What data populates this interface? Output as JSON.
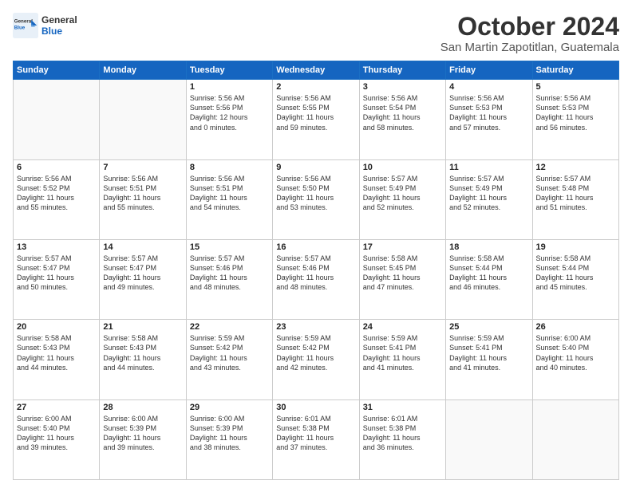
{
  "logo": {
    "general": "General",
    "blue": "Blue"
  },
  "title": "October 2024",
  "location": "San Martin Zapotitlan, Guatemala",
  "weekdays": [
    "Sunday",
    "Monday",
    "Tuesday",
    "Wednesday",
    "Thursday",
    "Friday",
    "Saturday"
  ],
  "weeks": [
    [
      {
        "day": "",
        "info": ""
      },
      {
        "day": "",
        "info": ""
      },
      {
        "day": "1",
        "info": "Sunrise: 5:56 AM\nSunset: 5:56 PM\nDaylight: 12 hours\nand 0 minutes."
      },
      {
        "day": "2",
        "info": "Sunrise: 5:56 AM\nSunset: 5:55 PM\nDaylight: 11 hours\nand 59 minutes."
      },
      {
        "day": "3",
        "info": "Sunrise: 5:56 AM\nSunset: 5:54 PM\nDaylight: 11 hours\nand 58 minutes."
      },
      {
        "day": "4",
        "info": "Sunrise: 5:56 AM\nSunset: 5:53 PM\nDaylight: 11 hours\nand 57 minutes."
      },
      {
        "day": "5",
        "info": "Sunrise: 5:56 AM\nSunset: 5:53 PM\nDaylight: 11 hours\nand 56 minutes."
      }
    ],
    [
      {
        "day": "6",
        "info": "Sunrise: 5:56 AM\nSunset: 5:52 PM\nDaylight: 11 hours\nand 55 minutes."
      },
      {
        "day": "7",
        "info": "Sunrise: 5:56 AM\nSunset: 5:51 PM\nDaylight: 11 hours\nand 55 minutes."
      },
      {
        "day": "8",
        "info": "Sunrise: 5:56 AM\nSunset: 5:51 PM\nDaylight: 11 hours\nand 54 minutes."
      },
      {
        "day": "9",
        "info": "Sunrise: 5:56 AM\nSunset: 5:50 PM\nDaylight: 11 hours\nand 53 minutes."
      },
      {
        "day": "10",
        "info": "Sunrise: 5:57 AM\nSunset: 5:49 PM\nDaylight: 11 hours\nand 52 minutes."
      },
      {
        "day": "11",
        "info": "Sunrise: 5:57 AM\nSunset: 5:49 PM\nDaylight: 11 hours\nand 52 minutes."
      },
      {
        "day": "12",
        "info": "Sunrise: 5:57 AM\nSunset: 5:48 PM\nDaylight: 11 hours\nand 51 minutes."
      }
    ],
    [
      {
        "day": "13",
        "info": "Sunrise: 5:57 AM\nSunset: 5:47 PM\nDaylight: 11 hours\nand 50 minutes."
      },
      {
        "day": "14",
        "info": "Sunrise: 5:57 AM\nSunset: 5:47 PM\nDaylight: 11 hours\nand 49 minutes."
      },
      {
        "day": "15",
        "info": "Sunrise: 5:57 AM\nSunset: 5:46 PM\nDaylight: 11 hours\nand 48 minutes."
      },
      {
        "day": "16",
        "info": "Sunrise: 5:57 AM\nSunset: 5:46 PM\nDaylight: 11 hours\nand 48 minutes."
      },
      {
        "day": "17",
        "info": "Sunrise: 5:58 AM\nSunset: 5:45 PM\nDaylight: 11 hours\nand 47 minutes."
      },
      {
        "day": "18",
        "info": "Sunrise: 5:58 AM\nSunset: 5:44 PM\nDaylight: 11 hours\nand 46 minutes."
      },
      {
        "day": "19",
        "info": "Sunrise: 5:58 AM\nSunset: 5:44 PM\nDaylight: 11 hours\nand 45 minutes."
      }
    ],
    [
      {
        "day": "20",
        "info": "Sunrise: 5:58 AM\nSunset: 5:43 PM\nDaylight: 11 hours\nand 44 minutes."
      },
      {
        "day": "21",
        "info": "Sunrise: 5:58 AM\nSunset: 5:43 PM\nDaylight: 11 hours\nand 44 minutes."
      },
      {
        "day": "22",
        "info": "Sunrise: 5:59 AM\nSunset: 5:42 PM\nDaylight: 11 hours\nand 43 minutes."
      },
      {
        "day": "23",
        "info": "Sunrise: 5:59 AM\nSunset: 5:42 PM\nDaylight: 11 hours\nand 42 minutes."
      },
      {
        "day": "24",
        "info": "Sunrise: 5:59 AM\nSunset: 5:41 PM\nDaylight: 11 hours\nand 41 minutes."
      },
      {
        "day": "25",
        "info": "Sunrise: 5:59 AM\nSunset: 5:41 PM\nDaylight: 11 hours\nand 41 minutes."
      },
      {
        "day": "26",
        "info": "Sunrise: 6:00 AM\nSunset: 5:40 PM\nDaylight: 11 hours\nand 40 minutes."
      }
    ],
    [
      {
        "day": "27",
        "info": "Sunrise: 6:00 AM\nSunset: 5:40 PM\nDaylight: 11 hours\nand 39 minutes."
      },
      {
        "day": "28",
        "info": "Sunrise: 6:00 AM\nSunset: 5:39 PM\nDaylight: 11 hours\nand 39 minutes."
      },
      {
        "day": "29",
        "info": "Sunrise: 6:00 AM\nSunset: 5:39 PM\nDaylight: 11 hours\nand 38 minutes."
      },
      {
        "day": "30",
        "info": "Sunrise: 6:01 AM\nSunset: 5:38 PM\nDaylight: 11 hours\nand 37 minutes."
      },
      {
        "day": "31",
        "info": "Sunrise: 6:01 AM\nSunset: 5:38 PM\nDaylight: 11 hours\nand 36 minutes."
      },
      {
        "day": "",
        "info": ""
      },
      {
        "day": "",
        "info": ""
      }
    ]
  ]
}
